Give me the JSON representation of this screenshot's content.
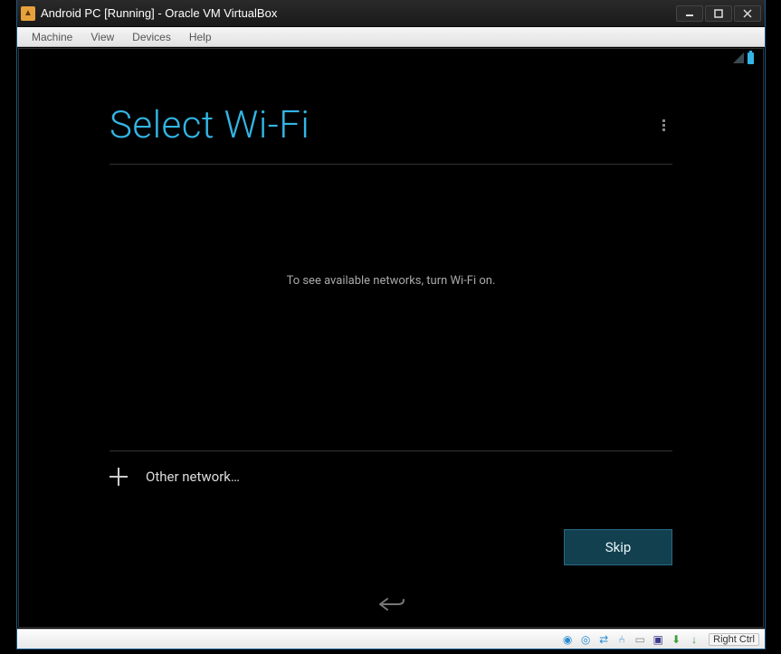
{
  "window": {
    "title": "Android PC [Running] - Oracle VM VirtualBox"
  },
  "menubar": {
    "machine": "Machine",
    "view": "View",
    "devices": "Devices",
    "help": "Help"
  },
  "android": {
    "page_title": "Select Wi-Fi",
    "hint": "To see available networks, turn Wi-Fi on.",
    "other_network": "Other network…",
    "skip": "Skip"
  },
  "statusbar": {
    "host_key": "Right Ctrl"
  }
}
